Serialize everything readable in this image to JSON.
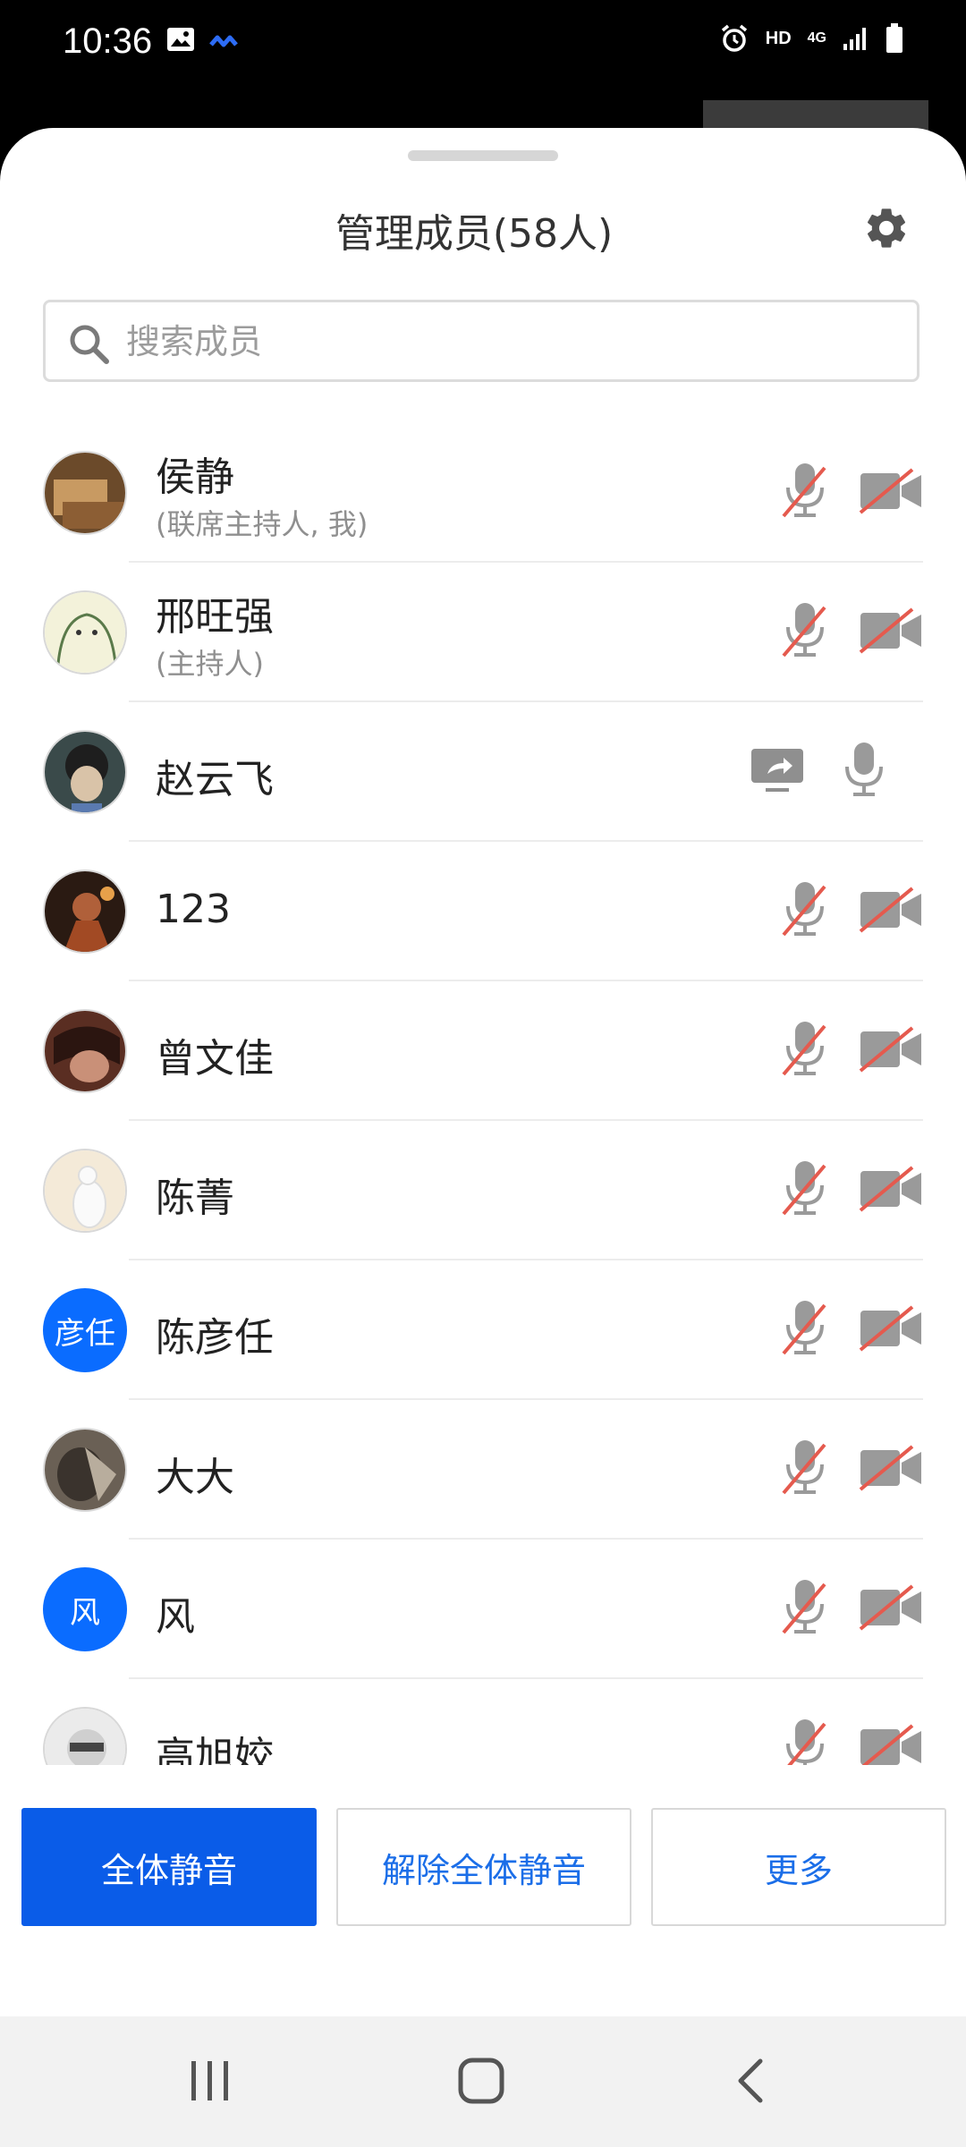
{
  "status_bar": {
    "time": "10:36",
    "left_icons": [
      "image-icon",
      "app-notification-icon"
    ],
    "right_icons": [
      "alarm-icon",
      "hd-icon",
      "4g-icon",
      "signal-icon",
      "battery-icon"
    ],
    "hd_label": "HD",
    "network_label": "4G"
  },
  "sheet": {
    "title": "管理成员(58人)",
    "search_placeholder": "搜索成员"
  },
  "members": [
    {
      "name": "侯静",
      "role": "(联席主持人, 我)",
      "mic": "muted",
      "camera": "off"
    },
    {
      "name": "邢旺强",
      "role": "(主持人)",
      "mic": "muted",
      "camera": "off"
    },
    {
      "name": "赵云飞",
      "role": "",
      "mic": "on",
      "screen_share": true
    },
    {
      "name": "123",
      "role": "",
      "mic": "muted",
      "camera": "off"
    },
    {
      "name": "曾文佳",
      "role": "",
      "mic": "muted",
      "camera": "off"
    },
    {
      "name": "陈菁",
      "role": "",
      "mic": "muted",
      "camera": "off"
    },
    {
      "name": "陈彦任",
      "role": "",
      "avatar_text": "彦任",
      "mic": "muted",
      "camera": "off"
    },
    {
      "name": "大大",
      "role": "",
      "mic": "muted",
      "camera": "off"
    },
    {
      "name": "风",
      "role": "",
      "avatar_text": "风",
      "mic": "muted",
      "camera": "off"
    },
    {
      "name": "高旭姣",
      "role": "",
      "mic": "muted",
      "camera": "off"
    }
  ],
  "buttons": {
    "mute_all": "全体静音",
    "unmute_all": "解除全体静音",
    "more": "更多"
  },
  "colors": {
    "accent": "#0a5ce8",
    "avatar_blue": "#0a6cff",
    "muted_slash": "#e55a4e",
    "icon_gray": "#9a9a9a"
  }
}
